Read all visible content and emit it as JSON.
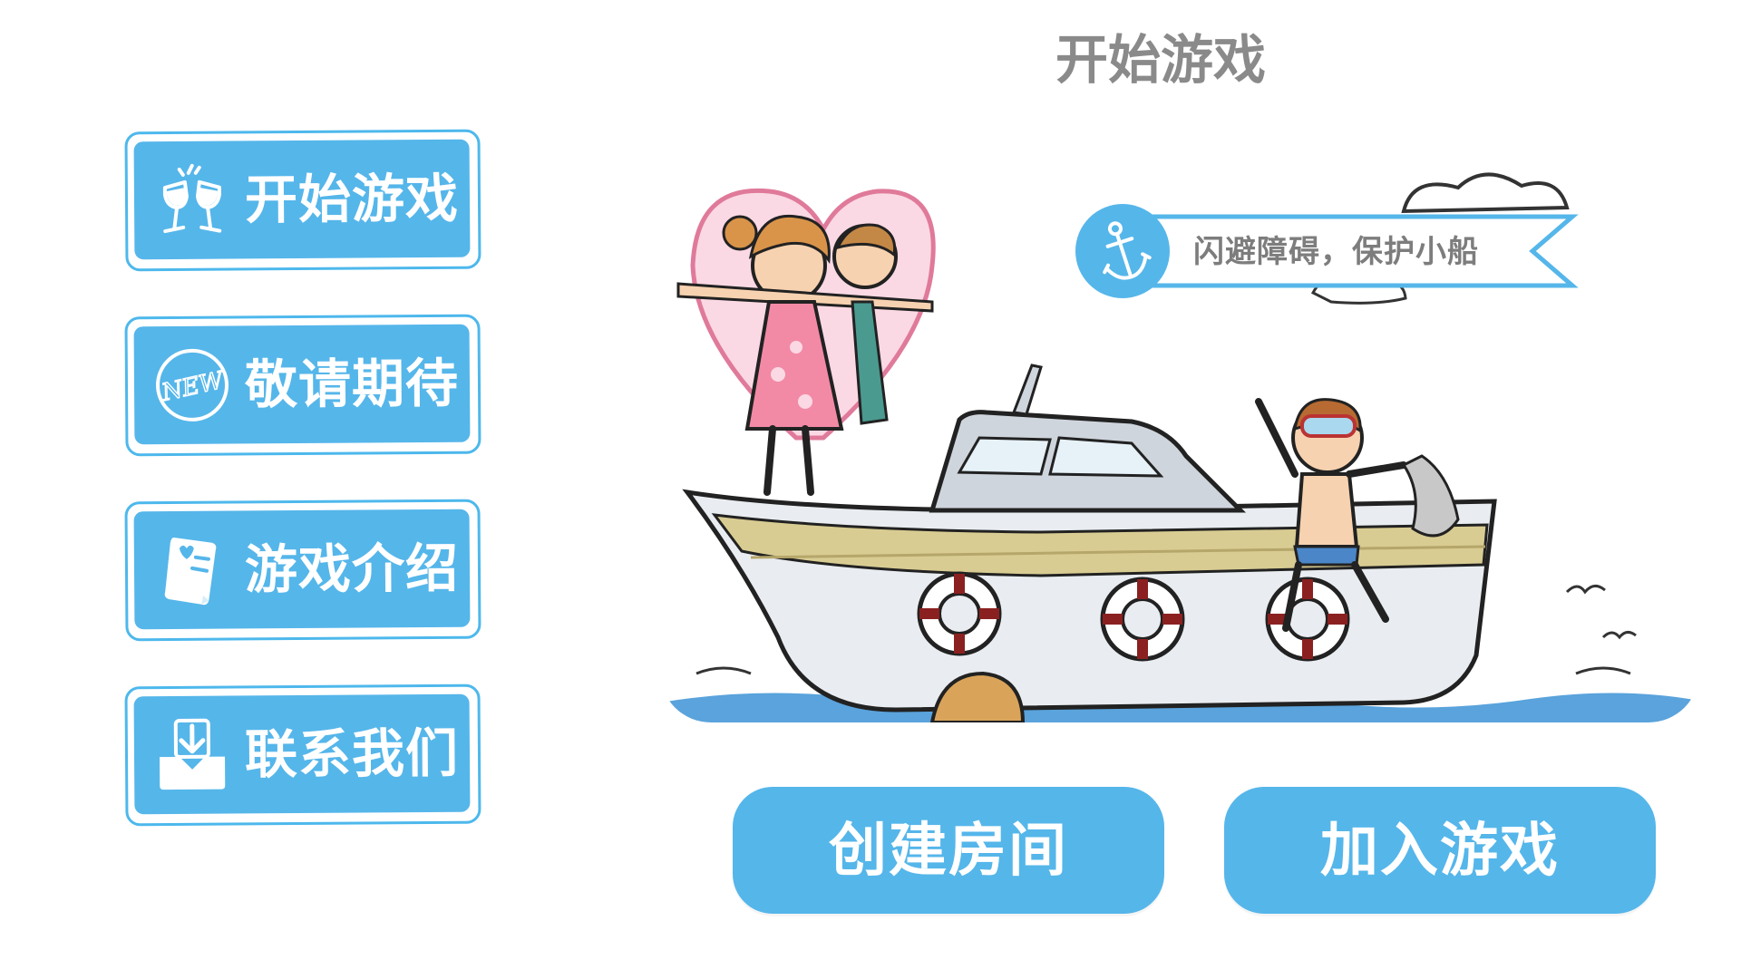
{
  "page_title": "开始游戏",
  "menu": [
    {
      "label": "开始游戏",
      "icon": "champagne-glasses-icon"
    },
    {
      "label": "敬请期待",
      "icon": "new-badge-icon",
      "icon_text": "NEW"
    },
    {
      "label": "游戏介绍",
      "icon": "document-icon"
    },
    {
      "label": "联系我们",
      "icon": "download-inbox-icon"
    }
  ],
  "game_card": {
    "tagline": "闪避障碍，保护小船",
    "tag_icon": "anchor-icon"
  },
  "actions": {
    "create_room": "创建房间",
    "join_game": "加入游戏"
  },
  "colors": {
    "accent": "#55b6ea",
    "accent_border": "#4db8ec",
    "title_gray": "#8a8a8a",
    "tag_text": "#7d7d7d"
  }
}
